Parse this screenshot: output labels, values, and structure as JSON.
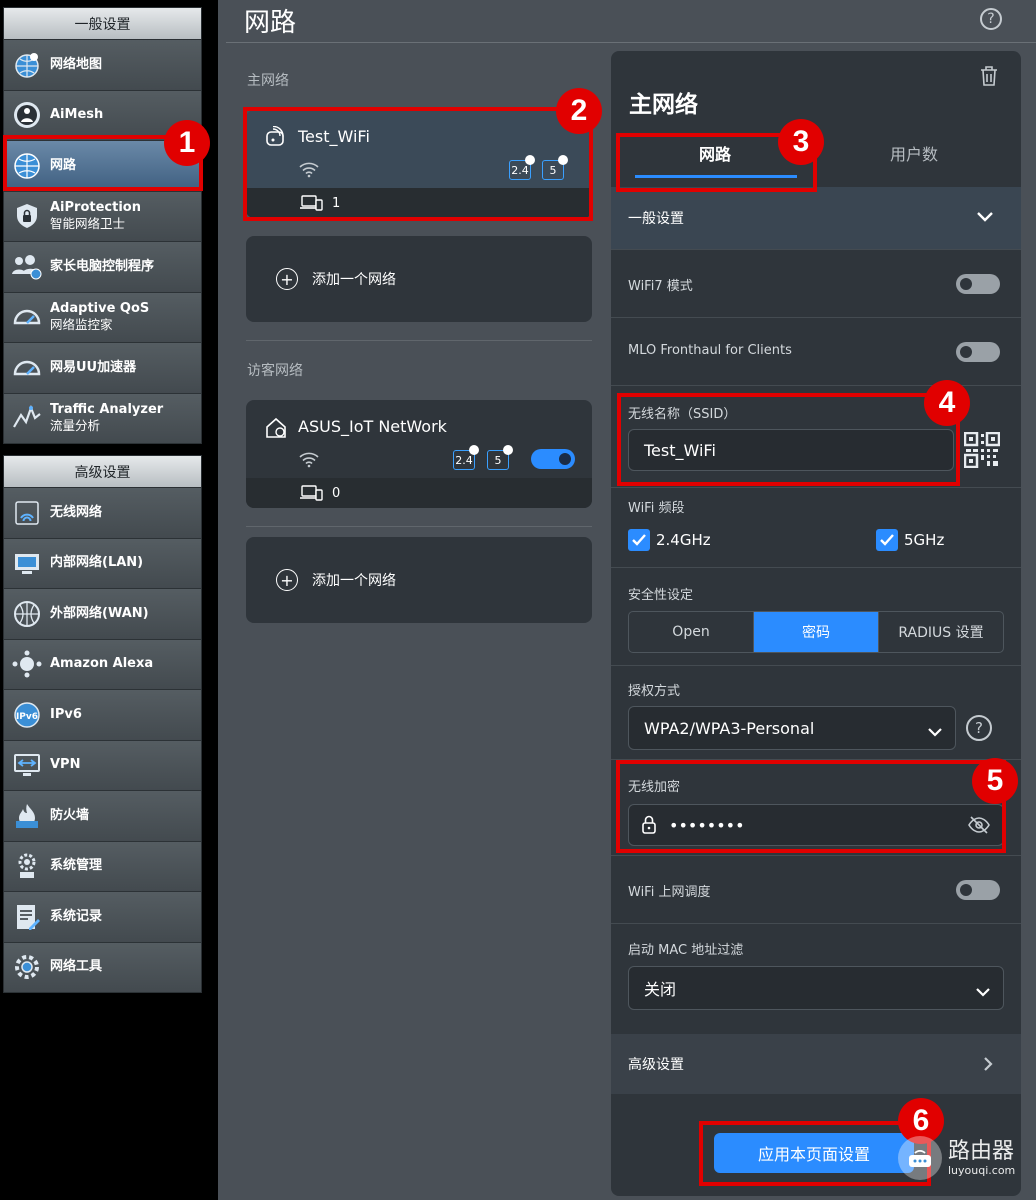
{
  "sidebar": {
    "general_header": "一般设置",
    "advanced_header": "高级设置",
    "general_items": [
      {
        "label": "网络地图",
        "label2": "",
        "icon": "globe-map-icon"
      },
      {
        "label": "AiMesh",
        "label2": "",
        "icon": "aimesh-icon"
      },
      {
        "label": "网路",
        "label2": "",
        "icon": "globe-network-icon"
      },
      {
        "label": "AiProtection",
        "label2": "智能网络卫士",
        "icon": "shield-lock-icon"
      },
      {
        "label": "家长电脑控制程序",
        "label2": "",
        "icon": "parental-control-icon"
      },
      {
        "label": "Adaptive QoS",
        "label2": "网络监控家",
        "icon": "speedometer-icon"
      },
      {
        "label": "网易UU加速器",
        "label2": "",
        "icon": "speedometer-icon"
      },
      {
        "label": "Traffic Analyzer",
        "label2": "流量分析",
        "icon": "traffic-chart-icon"
      }
    ],
    "advanced_items": [
      {
        "label": "无线网络",
        "icon": "wireless-icon"
      },
      {
        "label": "内部网络(LAN)",
        "icon": "lan-icon"
      },
      {
        "label": "外部网络(WAN)",
        "icon": "wan-globe-icon"
      },
      {
        "label": "Amazon Alexa",
        "icon": "alexa-icon"
      },
      {
        "label": "IPv6",
        "icon": "ipv6-icon"
      },
      {
        "label": "VPN",
        "icon": "vpn-icon"
      },
      {
        "label": "防火墙",
        "icon": "firewall-icon"
      },
      {
        "label": "系统管理",
        "icon": "system-admin-icon"
      },
      {
        "label": "系统记录",
        "icon": "system-log-icon"
      },
      {
        "label": "网络工具",
        "icon": "network-tools-icon"
      }
    ]
  },
  "main": {
    "title": "网路",
    "help": "?",
    "primary_section": "主网络",
    "guest_section": "访客网络",
    "networks": [
      {
        "name": "Test_WiFi",
        "band1": "2.4",
        "band2": "5",
        "devices": "1"
      },
      {
        "name": "ASUS_IoT NetWork",
        "band1": "2.4",
        "band2": "5",
        "devices": "0"
      }
    ],
    "add_network": "添加一个网络"
  },
  "panel": {
    "title": "主网络",
    "tabs": [
      "网路",
      "用户数"
    ],
    "general_settings": "一般设置",
    "wifi7_label": "WiFi7 模式",
    "mlo_label": "MLO Fronthaul for Clients",
    "ssid_label": "无线名称（SSID）",
    "ssid_value": "Test_WiFi",
    "band_label": "WiFi 频段",
    "band_24": "2.4GHz",
    "band_5": "5GHz",
    "security_label": "安全性设定",
    "security_options": [
      "Open",
      "密码",
      "RADIUS 设置"
    ],
    "auth_label": "授权方式",
    "auth_value": "WPA2/WPA3-Personal",
    "encrypt_label": "无线加密",
    "encrypt_value": "••••••••",
    "schedule_label": "WiFi 上网调度",
    "mac_label": "启动 MAC 地址过滤",
    "mac_value": "关闭",
    "advanced": "高级设置",
    "apply": "应用本页面设置"
  },
  "annotations": [
    "1",
    "2",
    "3",
    "4",
    "5",
    "6"
  ],
  "watermark": {
    "t1": "路由器",
    "t2": "luyouqi.com"
  },
  "colors": {
    "accent": "#2b8cff",
    "annotation": "#e10000",
    "panel": "#2f353b",
    "main_bg": "#4a5057"
  }
}
